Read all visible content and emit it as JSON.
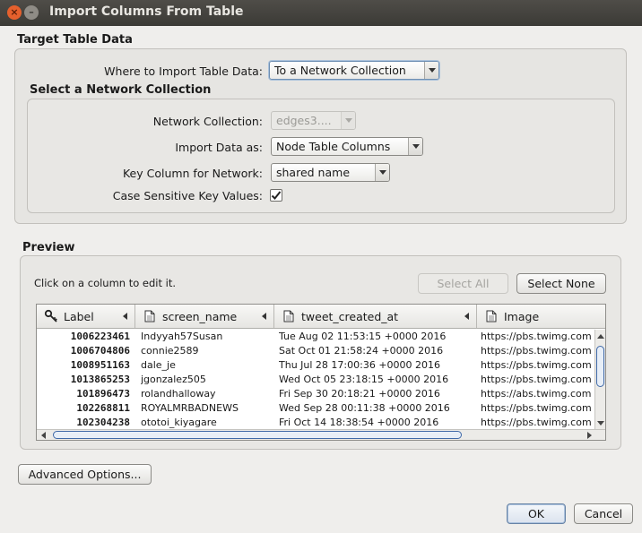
{
  "window": {
    "title": "Import Columns From Table"
  },
  "target": {
    "section_title": "Target Table Data",
    "where_label": "Where to Import Table Data:",
    "where_value": "To a Network Collection"
  },
  "network_collection": {
    "section_title": "Select a Network Collection",
    "collection_label": "Network Collection:",
    "collection_value": "edges3....",
    "import_as_label": "Import Data as:",
    "import_as_value": "Node Table Columns",
    "key_column_label": "Key Column for Network:",
    "key_column_value": "shared name",
    "case_sensitive_label": "Case Sensitive Key Values:",
    "case_sensitive_checked": true
  },
  "preview": {
    "section_title": "Preview",
    "hint": "Click on a column to edit it.",
    "select_all": "Select All",
    "select_none": "Select None",
    "columns": [
      {
        "label": "Label",
        "icon": "key-icon"
      },
      {
        "label": "screen_name",
        "icon": "document-icon"
      },
      {
        "label": "tweet_created_at",
        "icon": "document-icon"
      },
      {
        "label": "Image",
        "icon": "document-icon"
      }
    ],
    "rows": [
      [
        "1006223461",
        "Indyyah57Susan",
        "Tue Aug 02 11:53:15 +0000 2016",
        "https://pbs.twimg.com"
      ],
      [
        "1006704806",
        "connie2589",
        "Sat Oct 01 21:58:24 +0000 2016",
        "https://pbs.twimg.com"
      ],
      [
        "1008951163",
        "dale_je",
        "Thu Jul 28 17:00:36 +0000 2016",
        "https://pbs.twimg.com"
      ],
      [
        "1013865253",
        "jgonzalez505",
        "Wed Oct 05 23:18:15 +0000 2016",
        "https://pbs.twimg.com"
      ],
      [
        "101896473",
        "rolandhalloway",
        "Fri Sep 30 20:18:21 +0000 2016",
        "https://abs.twimg.com"
      ],
      [
        "102268811",
        "ROYALMRBADNEWS",
        "Wed Sep 28 00:11:38 +0000 2016",
        "https://pbs.twimg.com"
      ],
      [
        "102304238",
        "ototoi_kiyagare",
        "Fri Oct 14 18:38:54 +0000 2016",
        "https://pbs.twimg.com"
      ]
    ]
  },
  "footer": {
    "advanced": "Advanced Options...",
    "ok": "OK",
    "cancel": "Cancel"
  }
}
